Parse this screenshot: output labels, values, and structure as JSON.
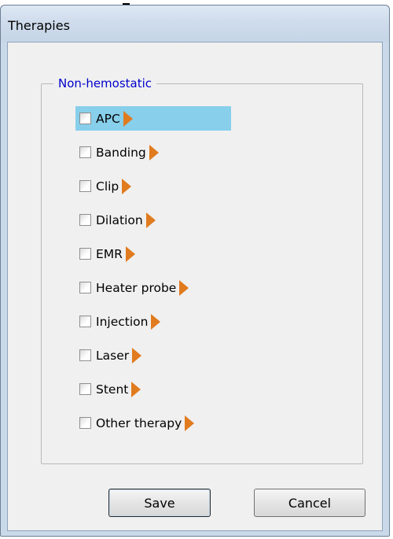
{
  "window": {
    "title": "Therapies"
  },
  "group": {
    "legend": "Non-hemostatic"
  },
  "items": [
    {
      "label": "APC",
      "checked": false,
      "selected": true
    },
    {
      "label": "Banding",
      "checked": false,
      "selected": false
    },
    {
      "label": "Clip",
      "checked": false,
      "selected": false
    },
    {
      "label": "Dilation",
      "checked": false,
      "selected": false
    },
    {
      "label": "EMR",
      "checked": false,
      "selected": false
    },
    {
      "label": "Heater probe",
      "checked": false,
      "selected": false
    },
    {
      "label": "Injection",
      "checked": false,
      "selected": false
    },
    {
      "label": "Laser",
      "checked": false,
      "selected": false
    },
    {
      "label": "Stent",
      "checked": false,
      "selected": false
    },
    {
      "label": "Other therapy",
      "checked": false,
      "selected": false
    }
  ],
  "buttons": {
    "save": "Save",
    "cancel": "Cancel"
  },
  "colors": {
    "selection": "#87cfeb",
    "arrow": "#e07b1f",
    "legend_text": "#0000cc",
    "window_frame": "#c9d9ea",
    "client_bg": "#f0f0f0"
  },
  "icons": {
    "item_arrow": "triangle-right-icon",
    "item_checkbox": "checkbox-icon"
  }
}
